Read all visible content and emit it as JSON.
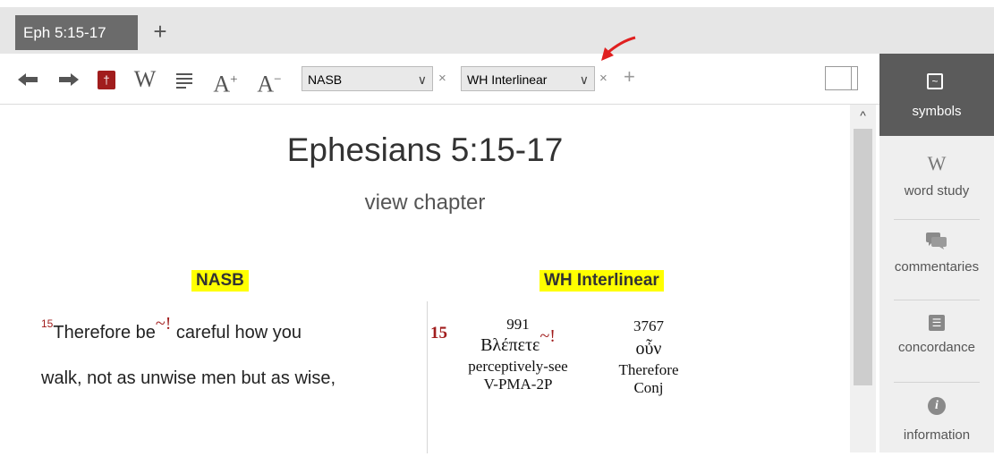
{
  "tab": {
    "label": "Eph 5:15-17",
    "add_label": "+"
  },
  "toolbar": {
    "back_glyph": "🡄",
    "forward_glyph": "🡆",
    "bible_glyph": "†",
    "word_glyph": "W",
    "lines_glyph": "≡",
    "font_increase": {
      "glyph": "A",
      "mark": "+"
    },
    "font_decrease": {
      "glyph": "A",
      "mark": "−"
    },
    "translation1": {
      "value": "NASB",
      "chevron": "∨",
      "remove": "×"
    },
    "translation2": {
      "value": "WH Interlinear",
      "chevron": "∨",
      "remove": "×"
    },
    "add_translation": "+"
  },
  "passage": {
    "title": "Ephesians 5:15-17",
    "view_chapter": "view chapter"
  },
  "columns": {
    "nasb": {
      "header": "NASB",
      "verse_number": "15",
      "line1_a": "Therefore be",
      "symbol": "~!",
      "line1_b": " careful how you",
      "line2": "walk, not as unwise men but as wise,"
    },
    "interlinear": {
      "header": "WH Interlinear",
      "verse_number": "15",
      "words": [
        {
          "strongs": "991",
          "greek": "Βλέπετε",
          "symbol": "~!",
          "gloss": "perceptively-see",
          "parse": "V-PMA-2P"
        },
        {
          "strongs": "3767",
          "greek": "οὖν",
          "gloss": "Therefore",
          "parse": "Conj"
        }
      ]
    }
  },
  "scrollbar": {
    "up_glyph": "^"
  },
  "sidebar": {
    "items": [
      {
        "label": "symbols",
        "icon": "tilde-box-icon",
        "glyph": "~",
        "active": true
      },
      {
        "label": "word study",
        "icon": "w-icon",
        "glyph": "W"
      },
      {
        "label": "commentaries",
        "icon": "speech-bubbles-icon"
      },
      {
        "label": "concordance",
        "icon": "list-icon",
        "glyph": "☰"
      },
      {
        "label": "information",
        "icon": "info-icon",
        "glyph": "i"
      }
    ]
  },
  "colors": {
    "accent_red": "#a11d1d",
    "highlight": "#ffff00",
    "sidebar_active": "#5b5b5b",
    "annotation_arrow": "#e02020"
  }
}
